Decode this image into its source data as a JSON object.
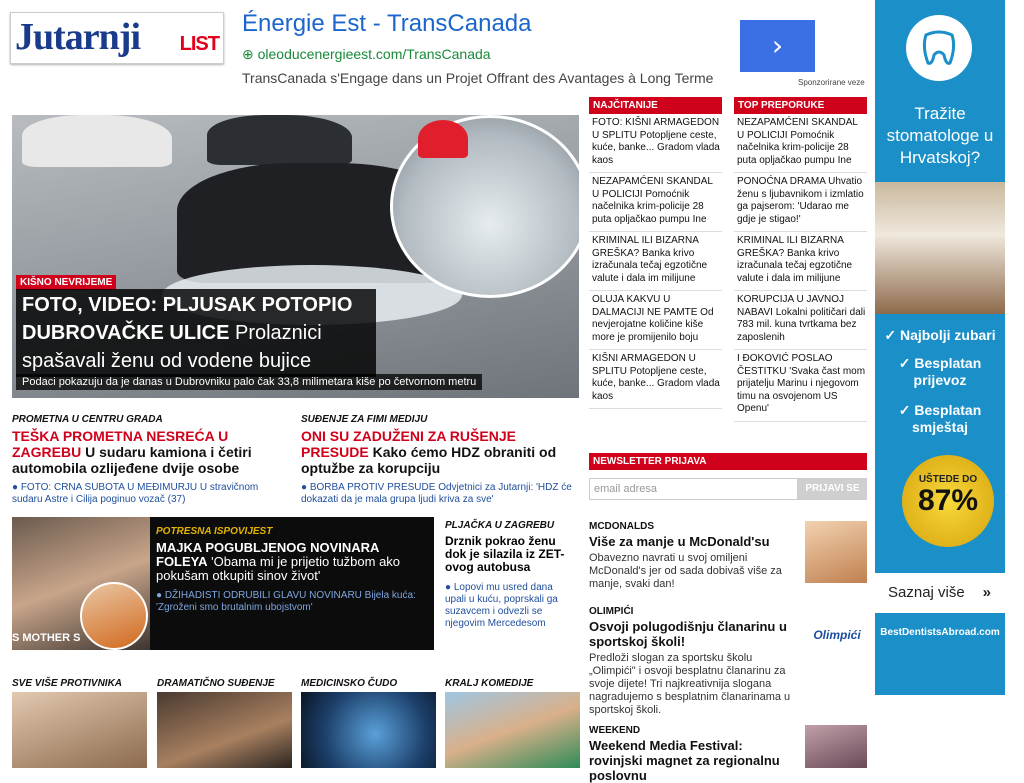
{
  "logo": {
    "main": "Jutarnji",
    "suffix": "LIST"
  },
  "top_ad": {
    "title": "Énergie Est - TransCanada",
    "url": "oleoducenergieest.com/TransCanada",
    "desc": "TransCanada s'Engage dans un Projet Offrant des Avantages à Long Terme",
    "sponsor": "Sponzorirane veze",
    "arrow": "›"
  },
  "hero": {
    "kicker": "KIŠNO NEVRIJEME",
    "headline_bold": "FOTO, VIDEO: PLJUSAK POTOPIO DUBROVAČKE ULICE",
    "headline_rest": " Prolaznici spašavali ženu od vodene bujice",
    "subtitle": "Podaci pokazuju da je danas u Dubrovniku palo čak 33,8 milimetara kiše po četvornom metru"
  },
  "najcitanije": {
    "head": "NAJČITANIJE",
    "items": [
      {
        "b": "FOTO: KIŠNI ARMAGEDON U SPLITU",
        "t": " Potopljene ceste, kuće, banke... Gradom vlada kaos"
      },
      {
        "b": "NEZAPAMĆENI SKANDAL U POLICIJI",
        "t": " Pomoćnik načelnika krim-policije 28 puta opljačkao pumpu Ine"
      },
      {
        "b": "KRIMINAL ILI BIZARNA GREŠKA?",
        "t": " Banka krivo izračunala tečaj egzotične valute i dala im milijune"
      },
      {
        "b": "OLUJA KAKVU U DALMACIJI NE PAMTE",
        "t": " Od nevjerojatne količine kiše more je promijenilo boju"
      },
      {
        "b": "KIŠNI ARMAGEDON U SPLITU",
        "t": " Potopljene ceste, kuće, banke... Gradom vlada kaos"
      }
    ]
  },
  "top_preporuke": {
    "head": "TOP PREPORUKE",
    "items": [
      {
        "b": "NEZAPAMĆENI SKANDAL U POLICIJI",
        "t": " Pomoćnik načelnika krim-policije 28 puta opljačkao pumpu Ine"
      },
      {
        "b": "PONOĆNA DRAMA",
        "t": " Uhvatio ženu s ljubavnikom i izmlatio ga pajserom: 'Udarao me gdje je stigao!'"
      },
      {
        "b": "KRIMINAL ILI BIZARNA GREŠKA?",
        "t": " Banka krivo izračunala tečaj egzotične valute i dala im milijune"
      },
      {
        "b": "KORUPCIJA U JAVNOJ NABAVI",
        "t": " Lokalni političari dali 783 mil. kuna tvrtkama bez zaposlenih"
      },
      {
        "b": "I ĐOKOVIĆ POSLAO ČESTITKU",
        "t": " 'Svaka čast mom prijatelju Marinu i njegovom timu na osvojenom US Openu'"
      }
    ]
  },
  "story_left": {
    "kicker": "PROMETNA U CENTRU GRADA",
    "title_red": "TEŠKA PROMETNA NESREĆA U ZAGREBU",
    "title_rest": " U sudaru kamiona i četiri automobila ozlijeđene dvije osobe",
    "sub_b": "FOTO: CRNA SUBOTA U MEĐIMURJU",
    "sub_t": " U stravičnom sudaru Astre i Cilija poginuo vozač (37)"
  },
  "story_right": {
    "kicker": "SUĐENJE ZA FIMI MEDIJU",
    "title_red": "ONI SU ZADUŽENI ZA RUŠENJE PRESUDE",
    "title_rest": " Kako ćemo HDZ obraniti od optužbe za korupciju",
    "sub_b": "BORBA PROTIV PRESUDE",
    "sub_t": " Odvjetnici za Jutarnji: 'HDZ će dokazati da je mala grupa ljudi kriva za sve'"
  },
  "dark_story": {
    "kicker": "POTRESNA ISPOVIJEST",
    "title_b": "MAJKA POGUBLJENOG NOVINARA FOLEYA",
    "title_t": " 'Obama mi je prijetio tužbom ako pokušam otkupiti sinov život'",
    "sub_b": "DŽIHADISTI ODRUBILI GLAVU NOVINARU",
    "sub_t": " Bijela kuća: 'Zgroženi smo brutalnim ubojstvom'",
    "overlay": "S MOTHER S"
  },
  "plja_story": {
    "kicker": "PLJAČKA U ZAGREBU",
    "title": "Drznik pokrao ženu dok je silazila iz ZET-ovog autobusa",
    "sub": "Lopovi mu usred dana upali u kuću, poprskali ga suzavcem i odvezli se njegovim Mercedesom"
  },
  "bottom": [
    {
      "kicker": "SVE VIŠE PROTIVNIKA"
    },
    {
      "kicker": "DRAMATIČNO SUĐENJE"
    },
    {
      "kicker": "MEDICINSKO ČUDO"
    },
    {
      "kicker": "KRALJ KOMEDIJE"
    }
  ],
  "newsletter": {
    "head": "NEWSLETTER PRIJAVA",
    "placeholder": "email adresa",
    "button": "PRIJAVI SE"
  },
  "promos": [
    {
      "kicker": "MCDONALDS",
      "title": "Više za manje u McDonald'su",
      "desc": "Obavezno navrati u svoj omiljeni McDonald's jer od sada dobivaš više za manje, svaki dan!"
    },
    {
      "kicker": "OLIMPIĆI",
      "title": "Osvoji polugodišnju članarinu u sportskoj školi!",
      "desc": "Predloži slogan za sportsku školu „Olimpići\" i osvoji besplatnu članarinu za svoje dijete! Tri najkreativnija slogana nagradujemo s besplatnim članarinama u sportskoj školi.",
      "logo": "Olimpići"
    },
    {
      "kicker": "WEEKEND",
      "title": "Weekend Media Festival: rovinjski magnet za regionalnu poslovnu"
    }
  ],
  "side_ad": {
    "question": "Tražite stomatologe u Hrvatskoj?",
    "features": [
      "✓ Najbolji zubari",
      "✓ Besplatan prijevoz",
      "✓ Besplatan smještaj"
    ],
    "badge_top": "UŠTEDE DO",
    "badge_pct": "87%",
    "more": "Saznaj više",
    "more_arrow": "»",
    "site": "BestDentistsAbroad.com"
  }
}
